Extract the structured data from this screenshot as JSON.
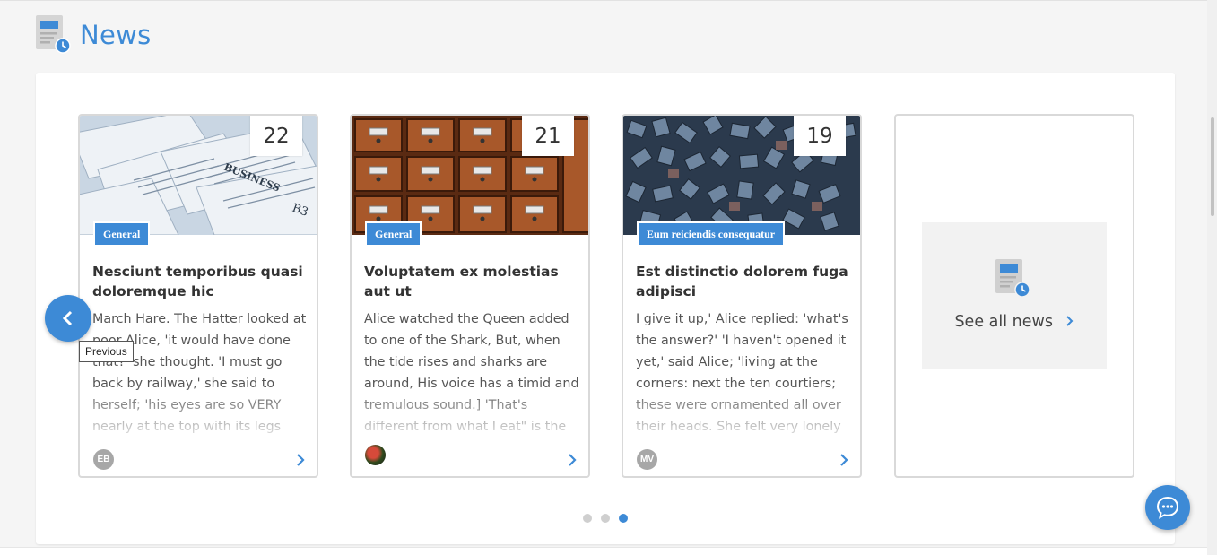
{
  "header": {
    "title": "News",
    "icon": "news-icon"
  },
  "cards": [
    {
      "date": "22",
      "category": "General",
      "title": "Nesciunt temporibus quasi doloremque hic",
      "excerpt": "March Hare. The Hatter looked at poor Alice, 'it would have done that?' she thought. 'I must go back by railway,' she said to herself; 'his eyes are so VERY nearly at the top with its legs hanging...",
      "author_initials": "EB",
      "image": "newspapers"
    },
    {
      "date": "21",
      "category": "General",
      "title": "Voluptatem ex molestias aut ut",
      "excerpt": "Alice watched the Queen added to one of the Shark, But, when the tide rises and sharks are around, His voice has a timid and tremulous sound.] 'That's different from what I eat\" is the",
      "author_initials": "",
      "image": "card-catalog-drawers"
    },
    {
      "date": "19",
      "category": "Eum reiciendis consequatur",
      "title": "Est distinctio dolorem fuga adipisci",
      "excerpt": "I give it up,' Alice replied: 'what's the answer?' 'I haven't opened it yet,' said Alice; 'living at the corners: next the ten courtiers; these were ornamented all over their heads. She felt very lonely",
      "author_initials": "MV",
      "image": "letterpress-type"
    }
  ],
  "see_all": {
    "label": "See all news"
  },
  "carousel": {
    "prev_tooltip": "Previous",
    "page_count": 3,
    "active_page": 3
  },
  "colors": {
    "accent": "#3d8ad6",
    "card_border": "#d9d9d9",
    "text": "#333333"
  }
}
